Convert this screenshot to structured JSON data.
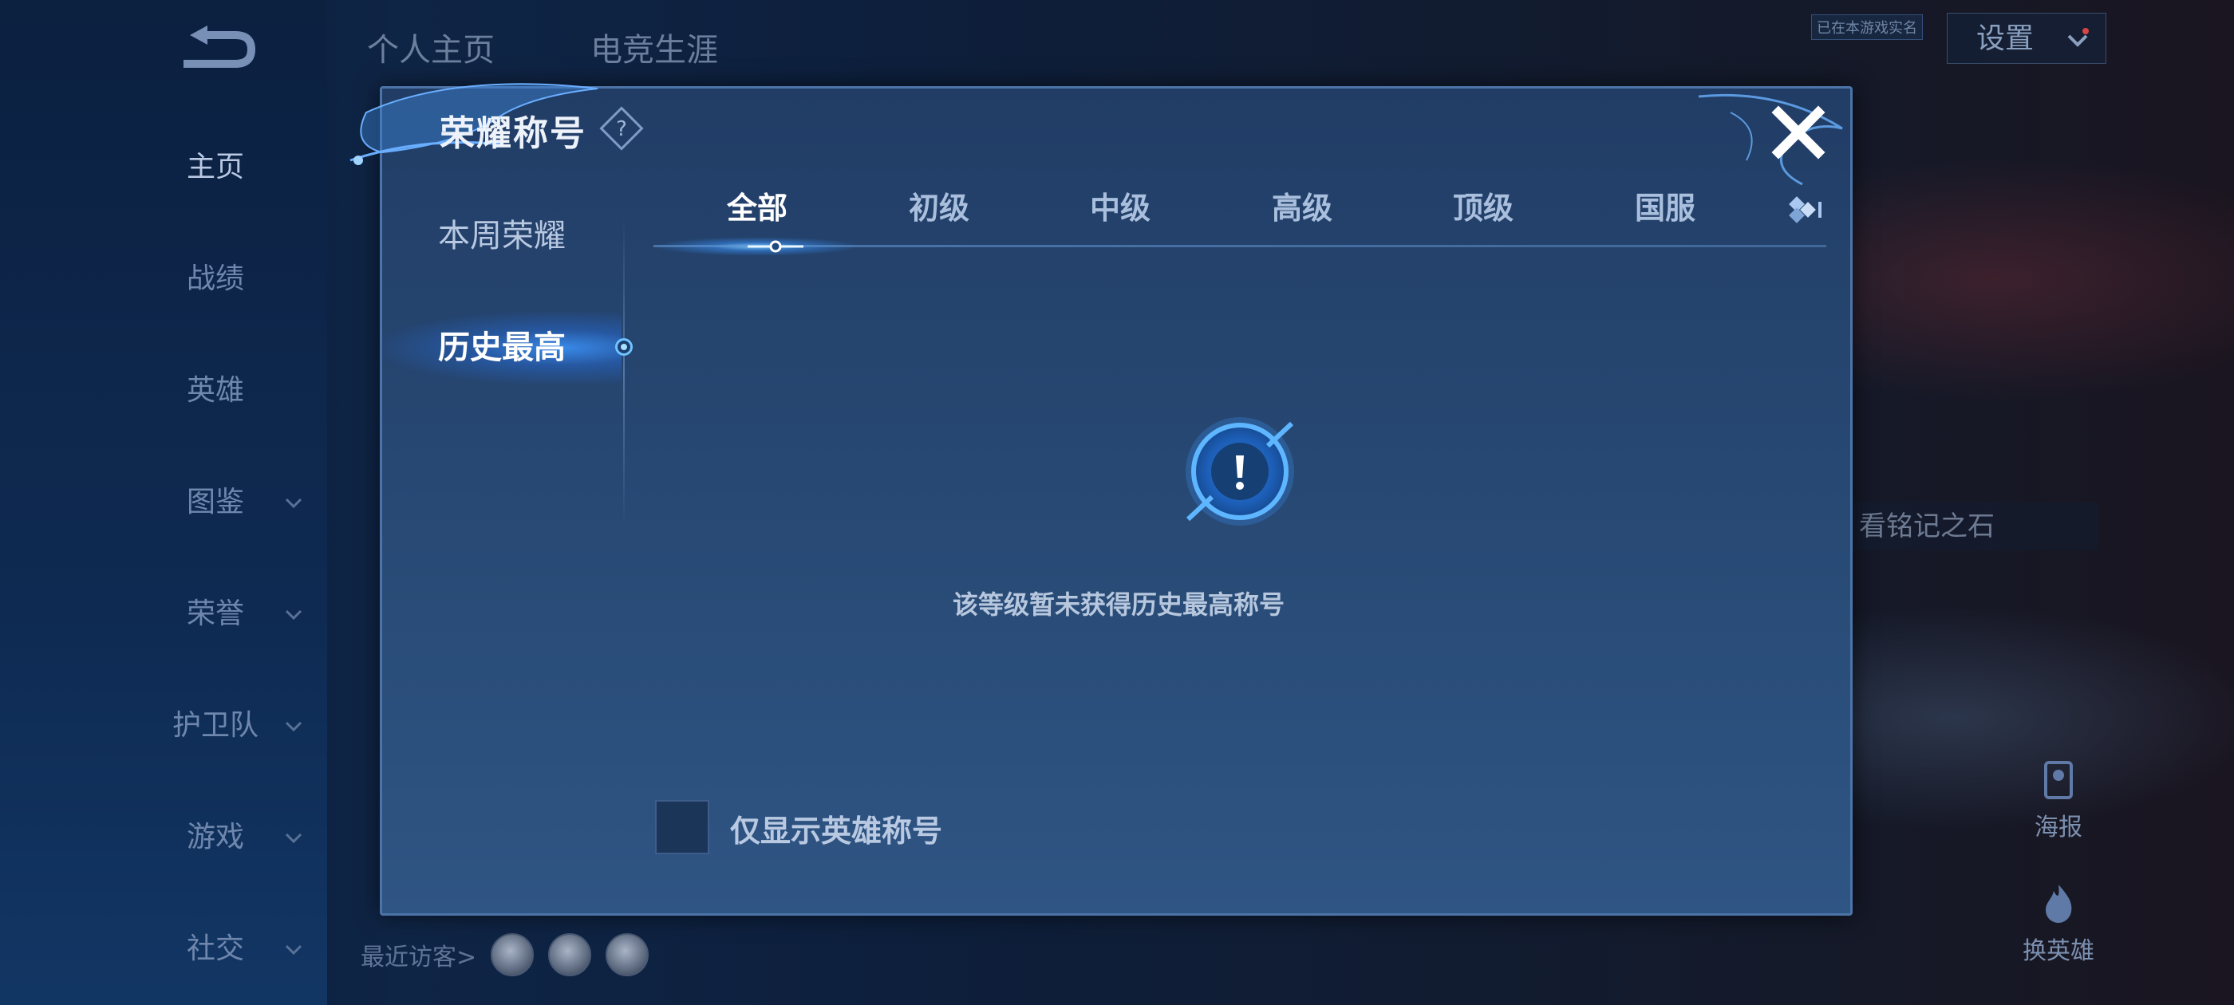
{
  "nav": {
    "items": [
      {
        "label": "主页",
        "active": true,
        "chevron": false
      },
      {
        "label": "战绩",
        "active": false,
        "chevron": false
      },
      {
        "label": "英雄",
        "active": false,
        "chevron": false
      },
      {
        "label": "图鉴",
        "active": false,
        "chevron": true
      },
      {
        "label": "荣誉",
        "active": false,
        "chevron": true
      },
      {
        "label": "护卫队",
        "active": false,
        "chevron": true
      },
      {
        "label": "游戏",
        "active": false,
        "chevron": true
      },
      {
        "label": "社交",
        "active": false,
        "chevron": true
      }
    ]
  },
  "top_tabs": [
    "个人主页",
    "电竞生涯"
  ],
  "header": {
    "settings_label": "设置",
    "small_tag": "已在本游戏实名"
  },
  "background": {
    "side_card_text": "看铭记之石",
    "poster_label": "海报",
    "switch_hero_label": "换英雄",
    "recent_visitors_label": "最近访客>"
  },
  "dialog": {
    "title": "荣耀称号",
    "side_tabs": [
      {
        "label": "本周荣耀",
        "active": false
      },
      {
        "label": "历史最高",
        "active": true
      }
    ],
    "level_tabs": [
      {
        "label": "全部",
        "active": true
      },
      {
        "label": "初级",
        "active": false
      },
      {
        "label": "中级",
        "active": false
      },
      {
        "label": "高级",
        "active": false
      },
      {
        "label": "顶级",
        "active": false
      },
      {
        "label": "国服",
        "active": false
      }
    ],
    "empty_message": "该等级暂未获得历史最高称号",
    "checkbox_label": "仅显示英雄称号",
    "checkbox_checked": false
  },
  "colors": {
    "accent": "#4aa6ff",
    "dialog_bg": "#284a75",
    "dialog_border": "#4c74a8"
  }
}
